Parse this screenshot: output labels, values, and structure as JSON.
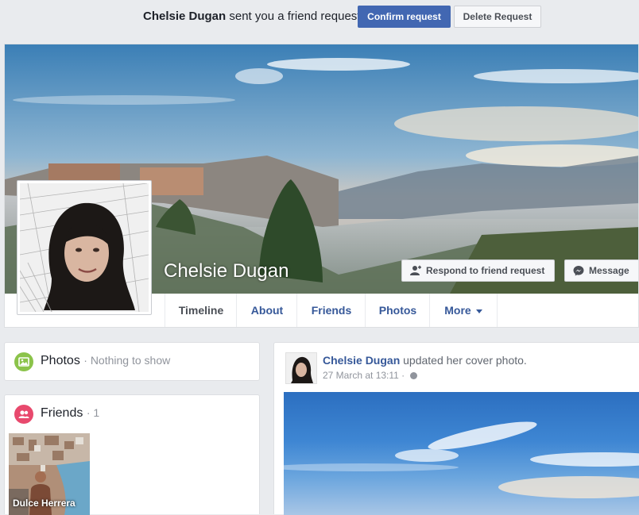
{
  "request_bar": {
    "requester": "Chelsie Dugan",
    "message": "sent you a friend request",
    "confirm_label": "Confirm request",
    "delete_label": "Delete Request"
  },
  "profile": {
    "name": "Chelsie Dugan",
    "respond_label": "Respond to friend request",
    "message_label": "Message"
  },
  "tabs": [
    {
      "label": "Timeline"
    },
    {
      "label": "About"
    },
    {
      "label": "Friends"
    },
    {
      "label": "Photos"
    },
    {
      "label": "More"
    }
  ],
  "photos_box": {
    "title": "Photos",
    "subtitle": "· Nothing to show",
    "icon": "photos-icon",
    "icon_color": "#8bc34a"
  },
  "friends_box": {
    "title": "Friends",
    "count": "· 1",
    "icon": "friends-icon",
    "icon_color": "#e8496d",
    "friends": [
      {
        "name": "Dulce Herrera"
      }
    ]
  },
  "post": {
    "author": "Chelsie Dugan",
    "action": "updated her cover photo.",
    "timestamp": "27 March at 13:11 ·"
  },
  "colors": {
    "primary": "#4267b2",
    "link": "#365899",
    "background": "#e9ebee"
  }
}
